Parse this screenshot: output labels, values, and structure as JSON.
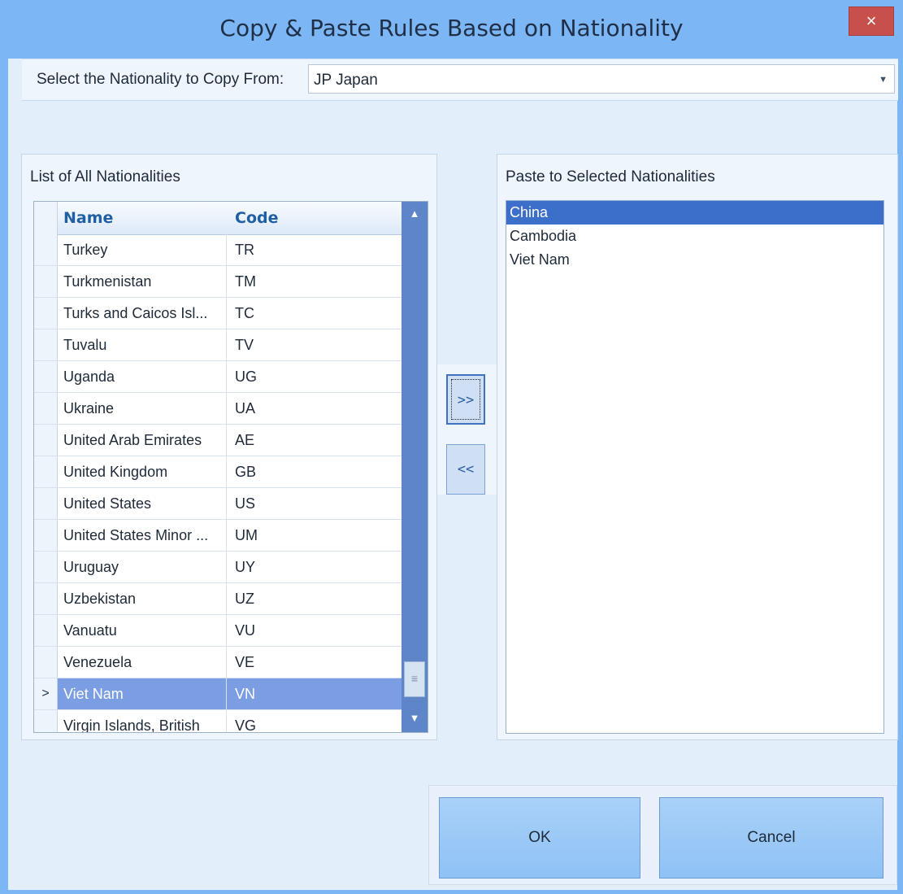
{
  "window": {
    "title": "Copy & Paste Rules Based on Nationality",
    "close_symbol": "×"
  },
  "copy_from": {
    "label": "Select the Nationality to Copy From:",
    "value": "JP Japan",
    "arrow": "▼"
  },
  "all_list": {
    "title": "List of All Nationalities",
    "columns": {
      "name": "Name",
      "code": "Code"
    },
    "rows": [
      {
        "name": "Turkey",
        "code": "TR",
        "marker": ""
      },
      {
        "name": "Turkmenistan",
        "code": "TM",
        "marker": ""
      },
      {
        "name": "Turks and Caicos Isl...",
        "code": "TC",
        "marker": ""
      },
      {
        "name": "Tuvalu",
        "code": "TV",
        "marker": ""
      },
      {
        "name": "Uganda",
        "code": "UG",
        "marker": ""
      },
      {
        "name": "Ukraine",
        "code": "UA",
        "marker": ""
      },
      {
        "name": "United Arab Emirates",
        "code": "AE",
        "marker": ""
      },
      {
        "name": "United Kingdom",
        "code": "GB",
        "marker": ""
      },
      {
        "name": "United States",
        "code": "US",
        "marker": ""
      },
      {
        "name": "United States Minor ...",
        "code": "UM",
        "marker": ""
      },
      {
        "name": "Uruguay",
        "code": "UY",
        "marker": ""
      },
      {
        "name": "Uzbekistan",
        "code": "UZ",
        "marker": ""
      },
      {
        "name": "Vanuatu",
        "code": "VU",
        "marker": ""
      },
      {
        "name": "Venezuela",
        "code": "VE",
        "marker": ""
      },
      {
        "name": "Viet Nam",
        "code": "VN",
        "marker": ">"
      },
      {
        "name": "Virgin Islands, British",
        "code": "VG",
        "marker": ""
      }
    ],
    "selected_index": 14,
    "scroll": {
      "up": "▲",
      "down": "▼",
      "thumb": "≡"
    }
  },
  "paste_list": {
    "title": "Paste to Selected Nationalities",
    "items": [
      "China",
      "Cambodia",
      "Viet Nam"
    ],
    "selected_index": 0
  },
  "move_buttons": {
    "add": ">>",
    "remove": "<<"
  },
  "actions": {
    "ok": "OK",
    "cancel": "Cancel"
  }
}
